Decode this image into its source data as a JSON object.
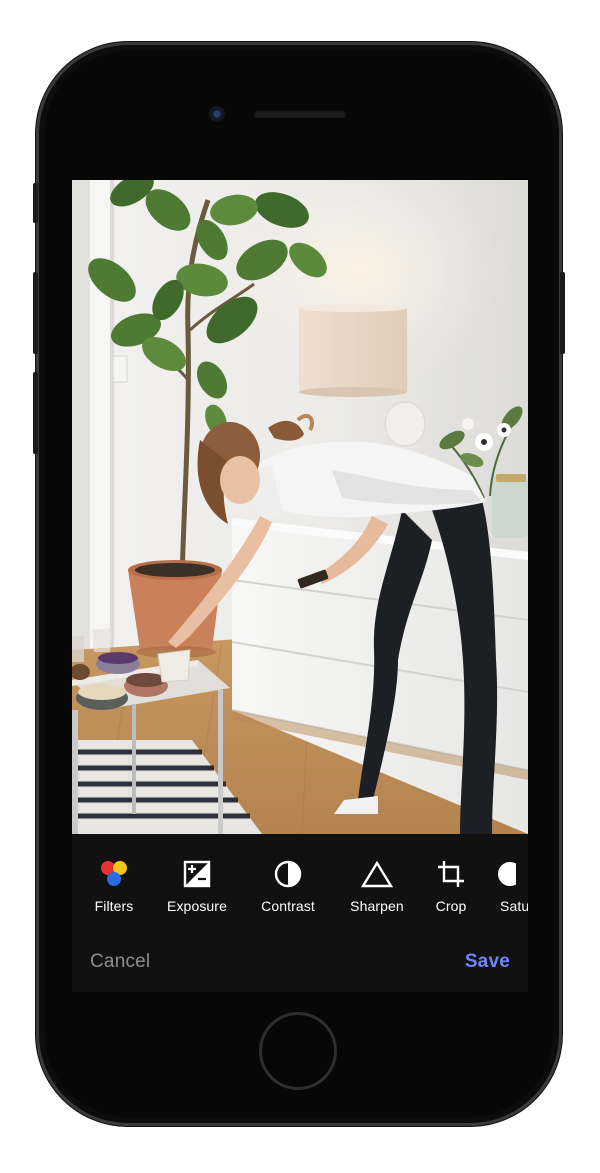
{
  "editor": {
    "tools": [
      {
        "label": "Filters",
        "icon": "filters-icon"
      },
      {
        "label": "Exposure",
        "icon": "exposure-icon"
      },
      {
        "label": "Contrast",
        "icon": "contrast-icon"
      },
      {
        "label": "Sharpen",
        "icon": "sharpen-icon"
      },
      {
        "label": "Crop",
        "icon": "crop-icon"
      },
      {
        "label": "Satu",
        "icon": "saturation-icon"
      }
    ],
    "cancel_label": "Cancel",
    "save_label": "Save"
  },
  "colors": {
    "background": "#111111",
    "save_accent": "#6f86f3",
    "cancel_text": "#8d8d8d",
    "filter_dots": [
      "#e8322e",
      "#f5c51c",
      "#2a6de0"
    ]
  }
}
